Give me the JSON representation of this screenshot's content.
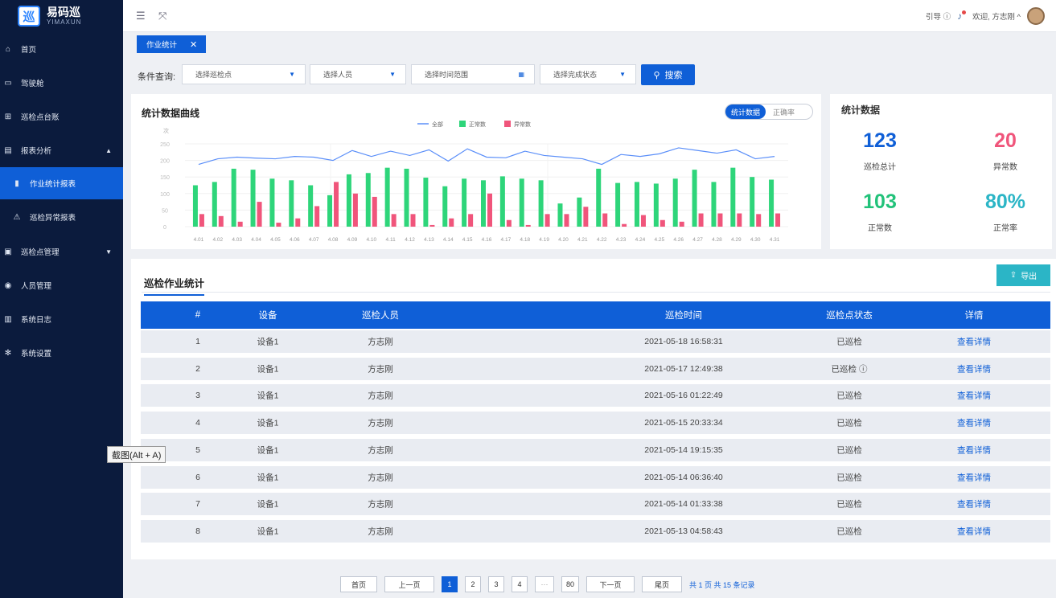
{
  "app": {
    "logo_mark": "巡",
    "name": "易码巡",
    "name_en": "YIMAXUN"
  },
  "sidebar": {
    "items": [
      {
        "label": "首页",
        "icon": "home-icon"
      },
      {
        "label": "驾驶舱",
        "icon": "monitor-icon"
      },
      {
        "label": "巡检点台账",
        "icon": "ledger-icon"
      },
      {
        "label": "报表分析",
        "icon": "report-icon",
        "caret": "▲"
      },
      {
        "label": "作业统计报表",
        "icon": "bar-chart-icon",
        "active": true
      },
      {
        "label": "巡检异常报表",
        "icon": "alert-icon"
      },
      {
        "label": "巡检点管理",
        "icon": "checkpoint-icon",
        "caret": "▼"
      },
      {
        "label": "人员管理",
        "icon": "user-icon"
      },
      {
        "label": "系统日志",
        "icon": "log-icon"
      },
      {
        "label": "系统设置",
        "icon": "gear-icon"
      }
    ]
  },
  "topbar": {
    "guide": "引导",
    "welcome": "欢迎, 方志刚"
  },
  "tabs": [
    {
      "label": "作业统计",
      "close": "✕"
    }
  ],
  "filters": {
    "label": "条件查询:",
    "point": "选择巡检点",
    "person": "选择人员",
    "time": "选择时间范围",
    "status": "选择完成状态",
    "search": "搜索"
  },
  "chart_panel": {
    "title": "统计数据曲线",
    "toggle_on": "统计数据",
    "toggle_off": "正确率",
    "unit": "次"
  },
  "chart_data": {
    "type": "bar",
    "categories": [
      "4.01",
      "4.02",
      "4.03",
      "4.04",
      "4.05",
      "4.06",
      "4.07",
      "4.08",
      "4.09",
      "4.10",
      "4.11",
      "4.12",
      "4.13",
      "4.14",
      "4.15",
      "4.16",
      "4.17",
      "4.18",
      "4.19",
      "4.20",
      "4.21",
      "4.22",
      "4.23",
      "4.24",
      "4.25",
      "4.26",
      "4.27",
      "4.28",
      "4.29",
      "4.30",
      "4.31"
    ],
    "series": [
      {
        "name": "全部",
        "type": "line",
        "values": [
          188,
          205,
          210,
          207,
          205,
          212,
          210,
          200,
          230,
          212,
          228,
          215,
          232,
          198,
          235,
          210,
          208,
          228,
          215,
          210,
          205,
          188,
          218,
          212,
          220,
          238,
          230,
          222,
          232,
          205,
          212
        ]
      },
      {
        "name": "正常数",
        "type": "bar",
        "values": [
          125,
          135,
          175,
          172,
          145,
          140,
          125,
          95,
          158,
          162,
          178,
          175,
          148,
          122,
          145,
          140,
          152,
          145,
          140,
          70,
          88,
          175,
          132,
          135,
          130,
          145,
          172,
          135,
          178,
          150,
          142
        ]
      },
      {
        "name": "异常数",
        "type": "bar",
        "values": [
          38,
          32,
          15,
          75,
          12,
          25,
          62,
          135,
          100,
          90,
          38,
          38,
          5,
          25,
          38,
          100,
          20,
          5,
          38,
          38,
          60,
          40,
          8,
          35,
          20,
          15,
          40,
          40,
          40,
          38,
          40
        ]
      }
    ],
    "ylim": [
      0,
      250
    ],
    "yticks": [
      0,
      50,
      100,
      150,
      200,
      250
    ],
    "colors": {
      "全部": "#5b8ff9",
      "正常数": "#2ed57a",
      "异常数": "#f0557b"
    },
    "legend": "top-center"
  },
  "stats": {
    "title": "统计数据",
    "total": "123",
    "total_label": "巡检总计",
    "abnormal": "20",
    "abnormal_label": "异常数",
    "normal": "103",
    "normal_label": "正常数",
    "rate": "80%",
    "rate_label": "正常率"
  },
  "table": {
    "title": "巡检作业统计",
    "export": "导出",
    "headers": [
      "#",
      "设备",
      "巡检人员",
      "巡检时间",
      "巡检点状态",
      "详情"
    ],
    "rows": [
      {
        "no": "1",
        "device": "设备1",
        "person": "方志刚",
        "time": "2021-05-18  16:58:31",
        "status": "已巡检",
        "detail": "查看详情"
      },
      {
        "no": "2",
        "device": "设备1",
        "person": "方志刚",
        "time": "2021-05-17  12:49:38",
        "status": "已巡检 ⓘ",
        "detail": "查看详情"
      },
      {
        "no": "3",
        "device": "设备1",
        "person": "方志刚",
        "time": "2021-05-16  01:22:49",
        "status": "已巡检",
        "detail": "查看详情"
      },
      {
        "no": "4",
        "device": "设备1",
        "person": "方志刚",
        "time": "2021-05-15  20:33:34",
        "status": "已巡检",
        "detail": "查看详情"
      },
      {
        "no": "5",
        "device": "设备1",
        "person": "方志刚",
        "time": "2021-05-14  19:15:35",
        "status": "已巡检",
        "detail": "查看详情"
      },
      {
        "no": "6",
        "device": "设备1",
        "person": "方志刚",
        "time": "2021-05-14  06:36:40",
        "status": "已巡检",
        "detail": "查看详情"
      },
      {
        "no": "7",
        "device": "设备1",
        "person": "方志刚",
        "time": "2021-05-14  01:33:38",
        "status": "已巡检",
        "detail": "查看详情"
      },
      {
        "no": "8",
        "device": "设备1",
        "person": "方志刚",
        "time": "2021-05-13  04:58:43",
        "status": "已巡检",
        "detail": "查看详情"
      }
    ]
  },
  "pager": {
    "first": "首页",
    "prev": "上一页",
    "pages": [
      "1",
      "2",
      "3",
      "4",
      "···",
      "80"
    ],
    "next": "下一页",
    "last": "尾页",
    "summary": "共 1 页  共 15 条记录"
  },
  "tooltip": "截图(Alt + A)"
}
